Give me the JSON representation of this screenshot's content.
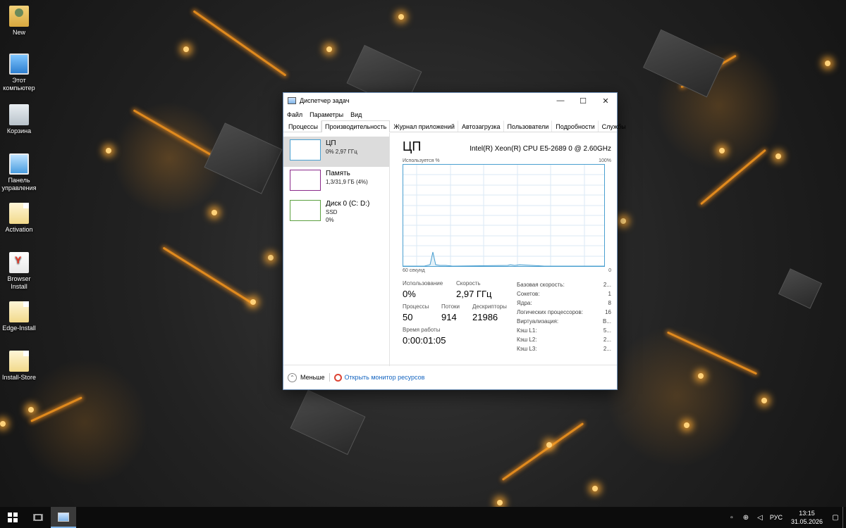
{
  "desktop": {
    "icons": [
      {
        "label": "New",
        "icon": "user-folder-icon"
      },
      {
        "label": "Этот компьютер",
        "icon": "computer-icon"
      },
      {
        "label": "Корзина",
        "icon": "recycle-bin-icon"
      },
      {
        "label": "Панель управления",
        "icon": "control-panel-icon"
      },
      {
        "label": "Activation",
        "icon": "file-icon"
      },
      {
        "label": "Browser Install",
        "icon": "yandex-browser-icon"
      },
      {
        "label": "Edge-Install",
        "icon": "file-icon"
      },
      {
        "label": "Install-Store",
        "icon": "file-icon"
      }
    ]
  },
  "window": {
    "title": "Диспетчер задач",
    "controls": {
      "minimize": "—",
      "maximize": "☐",
      "close": "✕"
    },
    "menu": [
      "Файл",
      "Параметры",
      "Вид"
    ],
    "tabs": [
      "Процессы",
      "Производительность",
      "Журнал приложений",
      "Автозагрузка",
      "Пользователи",
      "Подробности",
      "Службы"
    ],
    "active_tab": "Производительность",
    "resources": [
      {
        "name": "ЦП",
        "detail": "0% 2,97 ГГц",
        "detail2": ""
      },
      {
        "name": "Память",
        "detail": "1,3/31,9 ГБ (4%)",
        "detail2": ""
      },
      {
        "name": "Диск 0 (C: D:)",
        "detail": "SSD",
        "detail2": "0%"
      }
    ],
    "cpu_panel": {
      "title": "ЦП",
      "cpu_model": "Intel(R) Xeon(R) CPU E5-2689 0 @ 2.60GHz",
      "graph_label_left": "Используется %",
      "graph_label_right": "100%",
      "axis_left": "60 секунд",
      "axis_right": "0",
      "usage_label": "Использование",
      "usage_value": "0%",
      "speed_label": "Скорость",
      "speed_value": "2,97 ГГц",
      "processes_label": "Процессы",
      "processes_value": "50",
      "threads_label": "Потоки",
      "threads_value": "914",
      "handles_label": "Дескрипторы",
      "handles_value": "21986",
      "uptime_label": "Время работы",
      "uptime_value": "0:00:01:05",
      "specs": [
        {
          "key": "Базовая скорость:",
          "value": "2..."
        },
        {
          "key": "Сокетов:",
          "value": "1"
        },
        {
          "key": "Ядра:",
          "value": "8"
        },
        {
          "key": "Логических процессоров:",
          "value": "16"
        },
        {
          "key": "Виртуализация:",
          "value": "В..."
        },
        {
          "key": "Кэш L1:",
          "value": "5..."
        },
        {
          "key": "Кэш L2:",
          "value": "2..."
        },
        {
          "key": "Кэш L3:",
          "value": "2..."
        }
      ]
    },
    "footer": {
      "less_label": "Меньше",
      "monitor_link": "Открыть монитор ресурсов"
    }
  },
  "taskbar": {
    "tray_lang": "РУС",
    "time": "13:15",
    "date": "31.05.2026"
  },
  "colors": {
    "cpu": "#4a9fd0",
    "memory": "#8a2a8a",
    "disk": "#5ca040",
    "link": "#1565c0"
  }
}
